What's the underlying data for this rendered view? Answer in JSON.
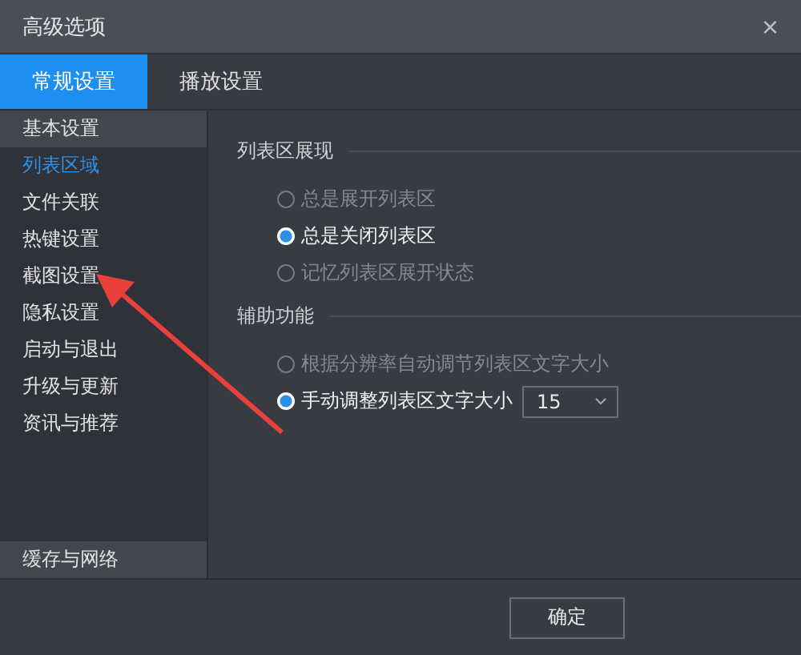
{
  "window": {
    "title": "高级选项",
    "close": "×"
  },
  "tabs": [
    {
      "label": "常规设置",
      "selected": true
    },
    {
      "label": "播放设置",
      "selected": false
    }
  ],
  "sidebar": {
    "items": [
      {
        "label": "基本设置",
        "selected": false,
        "highlighted": true
      },
      {
        "label": "列表区域",
        "selected": true,
        "highlighted": false
      },
      {
        "label": "文件关联",
        "selected": false,
        "highlighted": false
      },
      {
        "label": "热键设置",
        "selected": false,
        "highlighted": false
      },
      {
        "label": "截图设置",
        "selected": false,
        "highlighted": false
      },
      {
        "label": "隐私设置",
        "selected": false,
        "highlighted": false
      },
      {
        "label": "启动与退出",
        "selected": false,
        "highlighted": false
      },
      {
        "label": "升级与更新",
        "selected": false,
        "highlighted": false
      },
      {
        "label": "资讯与推荐",
        "selected": false,
        "highlighted": false
      }
    ],
    "bottom_items": [
      {
        "label": "缓存与网络",
        "selected": false,
        "highlighted": true
      }
    ]
  },
  "sections": [
    {
      "title": "列表区展现",
      "options": [
        {
          "label": "总是展开列表区",
          "selected": false,
          "disabled": true
        },
        {
          "label": "总是关闭列表区",
          "selected": true,
          "disabled": false
        },
        {
          "label": "记忆列表区展开状态",
          "selected": false,
          "disabled": true
        }
      ]
    },
    {
      "title": "辅助功能",
      "options": [
        {
          "label": "根据分辨率自动调节列表区文字大小",
          "selected": false,
          "disabled": true
        },
        {
          "label": "手动调整列表区文字大小",
          "selected": true,
          "disabled": false,
          "dropdown": {
            "value": "15"
          }
        }
      ]
    }
  ],
  "buttons": [
    "确定"
  ]
}
